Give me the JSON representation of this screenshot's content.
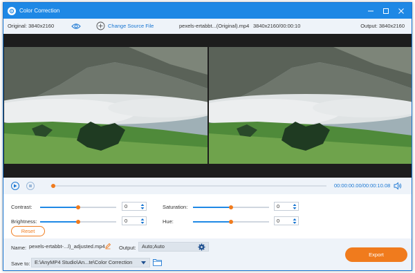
{
  "window": {
    "title": "Color Correction",
    "accent": "#1e88e5",
    "highlight": "#f07b1d"
  },
  "window_controls": [
    "minimize-icon",
    "maximize-icon",
    "close-icon"
  ],
  "infobar": {
    "original_label": "Original: 3840x2160",
    "change_source_label": "Change Source File",
    "file_name": "pexels-ertabbt...(Original).mp4",
    "file_info": "3840x2160/00:00:10",
    "output_label": "Output: 3840x2160"
  },
  "playback": {
    "current_time": "00:00:00.00",
    "total_time": "/00:00:10.08",
    "progress_fraction": 0.0
  },
  "adjustments": {
    "contrast": {
      "label": "Contrast:",
      "value": "0",
      "level": 0.5
    },
    "brightness": {
      "label": "Brightness:",
      "value": "0",
      "level": 0.5
    },
    "saturation": {
      "label": "Saturation:",
      "value": "0",
      "level": 0.5
    },
    "hue": {
      "label": "Hue:",
      "value": "0",
      "level": 0.5
    },
    "reset_label": "Reset"
  },
  "output_settings": {
    "name_label": "Name:",
    "name_value": "pexels-ertabbt-...l)_adjusted.mp4",
    "output_label": "Output:",
    "output_value": "Auto;Auto",
    "save_to_label": "Save to:",
    "save_to_value": "E:\\AnyMP4 Studio\\An...te\\Color Correction",
    "export_label": "Export"
  }
}
